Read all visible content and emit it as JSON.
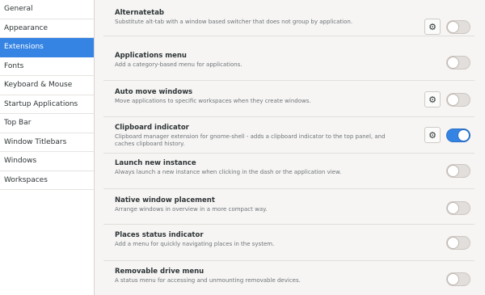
{
  "sidebar": {
    "items": [
      {
        "label": "General"
      },
      {
        "label": "Appearance"
      },
      {
        "label": "Extensions",
        "active": true
      },
      {
        "label": "Fonts"
      },
      {
        "label": "Keyboard & Mouse"
      },
      {
        "label": "Startup Applications"
      },
      {
        "label": "Top Bar"
      },
      {
        "label": "Window Titlebars"
      },
      {
        "label": "Windows"
      },
      {
        "label": "Workspaces"
      }
    ]
  },
  "extensions": [
    {
      "title": "Alternatetab",
      "description": "Substitute alt-tab with a window based switcher that does not group by application.",
      "settings_icon": "gear-icon",
      "enabled": false
    },
    {
      "title": "Applications menu",
      "description": "Add a category-based menu for applications.",
      "enabled": false
    },
    {
      "title": "Auto move windows",
      "description": "Move applications to specific workspaces when they create windows.",
      "settings_icon": "gear-icon",
      "enabled": false
    },
    {
      "title": "Clipboard indicator",
      "description": "Clipboard manager extension for gnome-shell - adds a clipboard indicator to the top panel, and caches clipboard history.",
      "settings_icon": "gear-icon",
      "enabled": true
    },
    {
      "title": "Launch new instance",
      "description": "Always launch a new instance when clicking in the dash or the application view.",
      "enabled": false
    },
    {
      "title": "Native window placement",
      "description": "Arrange windows in overview in a more compact way.",
      "enabled": false
    },
    {
      "title": "Places status indicator",
      "description": "Add a menu for quickly navigating places in the system.",
      "enabled": false
    },
    {
      "title": "Removable drive menu",
      "description": "A status menu for accessing and unmounting removable devices.",
      "enabled": false
    }
  ],
  "colors": {
    "accent": "#3584e4",
    "background": "#f6f5f4",
    "sidebar_background": "#ffffff"
  }
}
